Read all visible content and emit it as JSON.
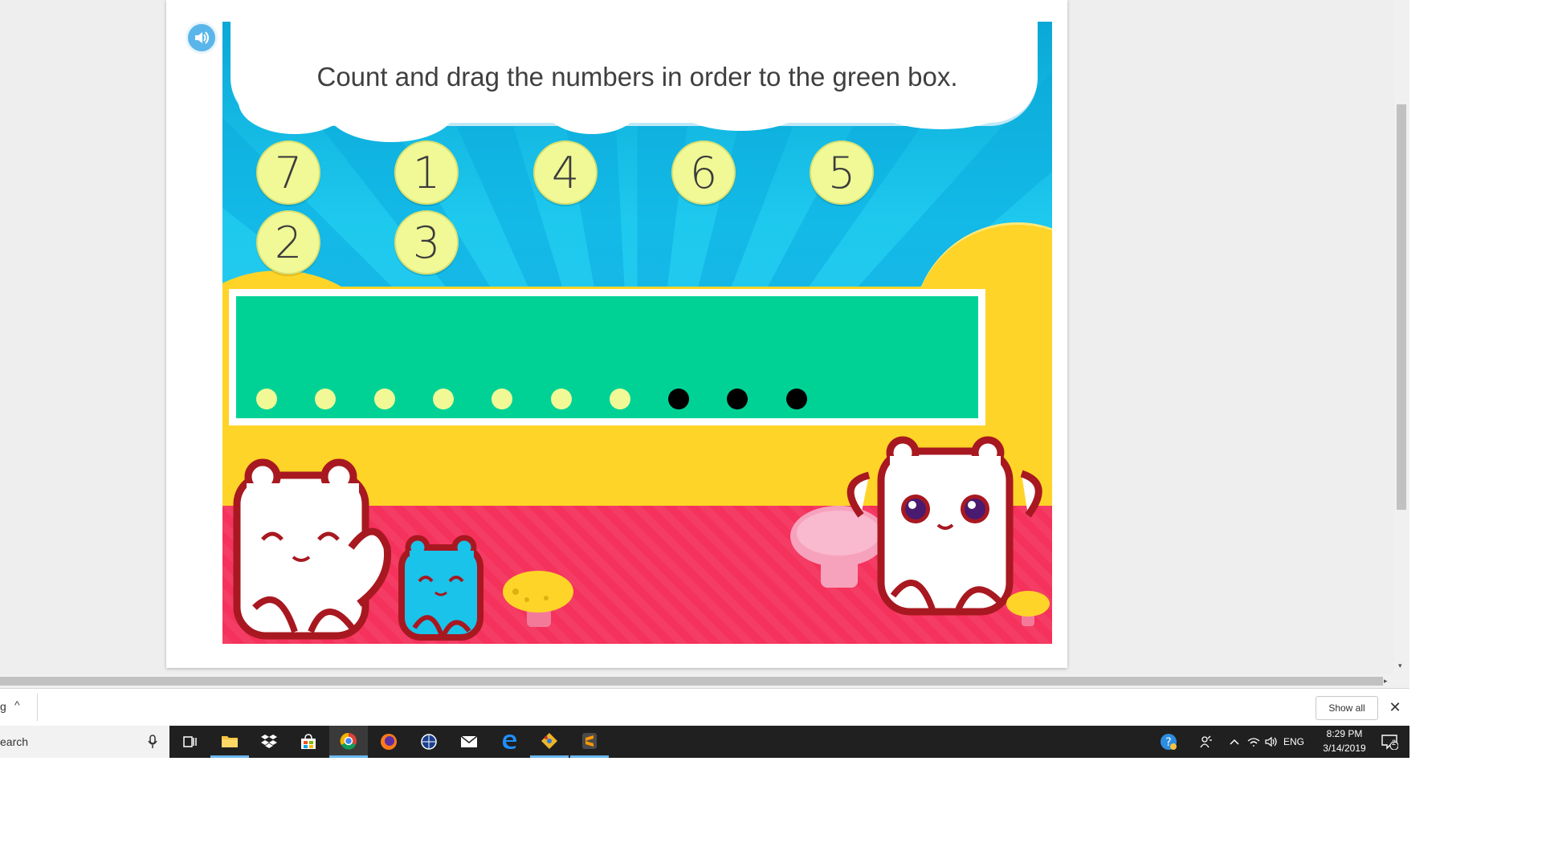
{
  "game": {
    "instruction": "Count and drag the numbers in order to the green box.",
    "tokens": [
      "7",
      "1",
      "4",
      "6",
      "5",
      "2",
      "3"
    ],
    "counting_dots": {
      "yellow_count": 7,
      "black_count": 3,
      "yellow_color": "#f0f996",
      "black_color": "#000000"
    },
    "colors": {
      "drop_zone": "#00d296",
      "token": "#f0f996",
      "sky": "#1ab8e6",
      "ground_yellow": "#ffd428",
      "ground_red": "#f4325c"
    }
  },
  "download_bar": {
    "item_text": "g",
    "show_all_label": "Show all",
    "close_glyph": "✕",
    "chevron_glyph": "^"
  },
  "taskbar": {
    "search_text": "earch",
    "tray_language": "ENG",
    "clock_time": "8:29 PM",
    "clock_date": "3/14/2019",
    "notification_count": "2",
    "icons": [
      "task-view",
      "file-explorer",
      "dropbox",
      "microsoft-store",
      "chrome",
      "firefox",
      "app-compass",
      "mail",
      "edge",
      "git",
      "sublime-text"
    ]
  }
}
